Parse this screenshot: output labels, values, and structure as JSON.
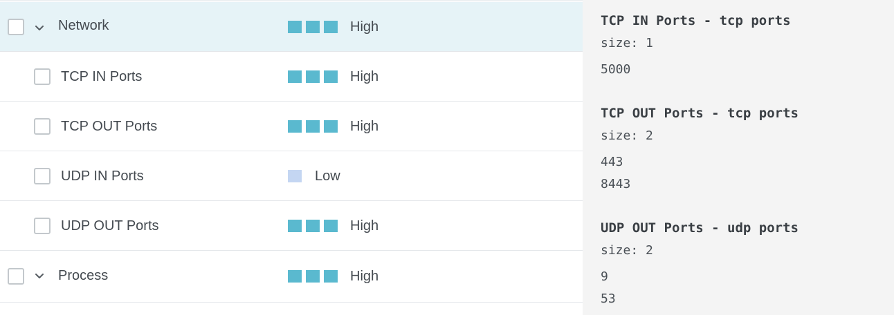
{
  "colors": {
    "severity_high": "#5ab9cf",
    "severity_low": "#c4d6f2",
    "selected_row_bg": "#e6f3f7",
    "panel_bg": "#f4f4f4"
  },
  "rows": [
    {
      "label": "Network",
      "severity": "High",
      "level": 3,
      "expandable": true,
      "selected": true
    },
    {
      "label": "TCP IN Ports",
      "severity": "High",
      "level": 3,
      "expandable": false,
      "selected": false
    },
    {
      "label": "TCP OUT Ports",
      "severity": "High",
      "level": 3,
      "expandable": false,
      "selected": false
    },
    {
      "label": "UDP IN Ports",
      "severity": "Low",
      "level": 1,
      "expandable": false,
      "selected": false
    },
    {
      "label": "UDP OUT Ports",
      "severity": "High",
      "level": 3,
      "expandable": false,
      "selected": false
    },
    {
      "label": "Process",
      "severity": "High",
      "level": 3,
      "expandable": true,
      "selected": false
    }
  ],
  "panel": {
    "size_prefix": "size: ",
    "sections": [
      {
        "title": "TCP IN Ports - tcp ports",
        "size": "1",
        "values": [
          "5000"
        ]
      },
      {
        "title": "TCP OUT Ports - tcp ports",
        "size": "2",
        "values": [
          "443",
          "8443"
        ]
      },
      {
        "title": "UDP OUT Ports - udp ports",
        "size": "2",
        "values": [
          "9",
          "53"
        ]
      }
    ]
  }
}
